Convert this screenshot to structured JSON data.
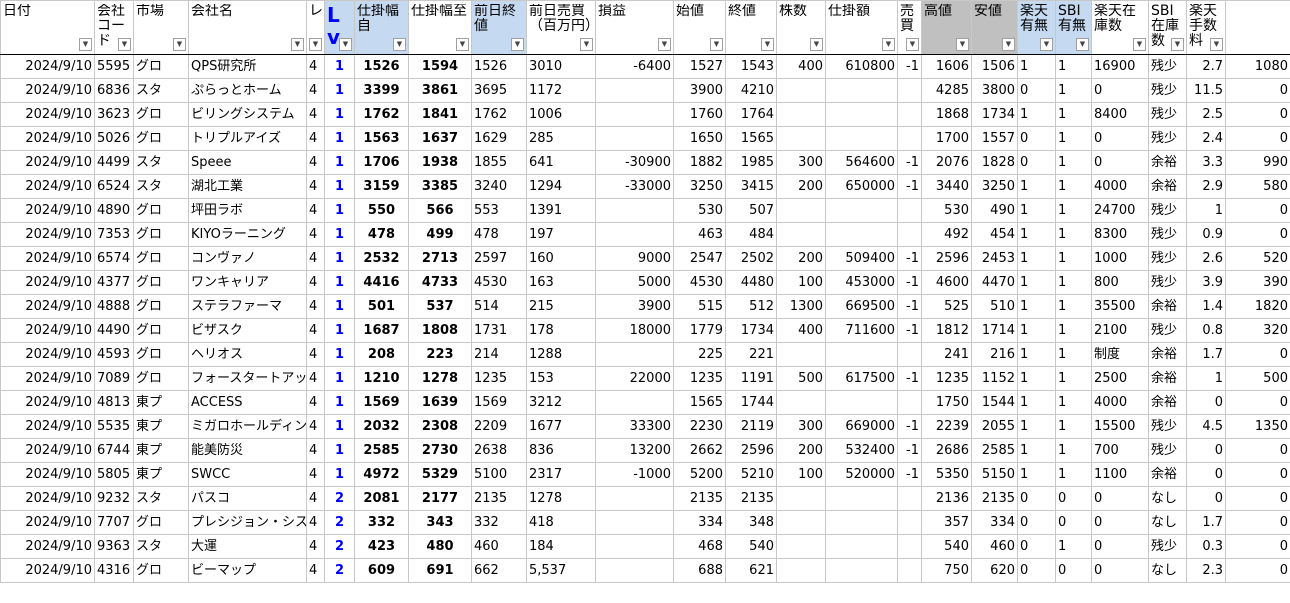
{
  "columns": [
    {
      "key": "date",
      "label": "日付"
    },
    {
      "key": "code",
      "label": "会社コード"
    },
    {
      "key": "market",
      "label": "市場"
    },
    {
      "key": "name",
      "label": "会社名"
    },
    {
      "key": "lev",
      "label": "レ"
    },
    {
      "key": "lv",
      "label": "Lv"
    },
    {
      "key": "from",
      "label": "仕掛幅自"
    },
    {
      "key": "to",
      "label": "仕掛幅至"
    },
    {
      "key": "prev_close",
      "label": "前日終値"
    },
    {
      "key": "prev_volume",
      "label": "前日売買（百万円）"
    },
    {
      "key": "pnl",
      "label": "損益"
    },
    {
      "key": "open",
      "label": "始値"
    },
    {
      "key": "close",
      "label": "終値"
    },
    {
      "key": "shares",
      "label": "株数"
    },
    {
      "key": "amount",
      "label": "仕掛額"
    },
    {
      "key": "side",
      "label": "売買"
    },
    {
      "key": "high",
      "label": "高値"
    },
    {
      "key": "low",
      "label": "安値"
    },
    {
      "key": "rakuten_ok",
      "label": "楽天有無"
    },
    {
      "key": "sbi_ok",
      "label": "SBI有無"
    },
    {
      "key": "rakuten_stock",
      "label": "楽天在庫数"
    },
    {
      "key": "sbi_stock",
      "label": "SBI在庫数"
    },
    {
      "key": "fee_rate",
      "label": "楽天手数料"
    },
    {
      "key": "fee",
      "label": ""
    }
  ],
  "rows": [
    {
      "date": "2024/9/10",
      "code": "5595",
      "market": "グロ",
      "name": "QPS研究所",
      "lev": "4",
      "lv": "1",
      "from": "1526",
      "to": "1594",
      "prev_close": "1526",
      "prev_volume": "3010",
      "pnl": "-6400",
      "open": "1527",
      "close": "1543",
      "shares": "400",
      "amount": "610800",
      "side": "-1",
      "high": "1606",
      "low": "1506",
      "rakuten_ok": "1",
      "sbi_ok": "1",
      "rakuten_stock": "16900",
      "sbi_stock": "残少",
      "fee_rate": "2.7",
      "fee": "1080"
    },
    {
      "date": "2024/9/10",
      "code": "6836",
      "market": "スタ",
      "name": "ぷらっとホーム",
      "lev": "4",
      "lv": "1",
      "from": "3399",
      "to": "3861",
      "prev_close": "3695",
      "prev_volume": "1172",
      "pnl": "",
      "open": "3900",
      "close": "4210",
      "shares": "",
      "amount": "",
      "side": "",
      "high": "4285",
      "low": "3800",
      "rakuten_ok": "0",
      "sbi_ok": "1",
      "rakuten_stock": "0",
      "sbi_stock": "残少",
      "fee_rate": "11.5",
      "fee": "0"
    },
    {
      "date": "2024/9/10",
      "code": "3623",
      "market": "グロ",
      "name": "ビリングシステム",
      "lev": "4",
      "lv": "1",
      "from": "1762",
      "to": "1841",
      "prev_close": "1762",
      "prev_volume": "1006",
      "pnl": "",
      "open": "1760",
      "close": "1764",
      "shares": "",
      "amount": "",
      "side": "",
      "high": "1868",
      "low": "1734",
      "rakuten_ok": "1",
      "sbi_ok": "1",
      "rakuten_stock": "8400",
      "sbi_stock": "残少",
      "fee_rate": "2.5",
      "fee": "0"
    },
    {
      "date": "2024/9/10",
      "code": "5026",
      "market": "グロ",
      "name": "トリプルアイズ",
      "lev": "4",
      "lv": "1",
      "from": "1563",
      "to": "1637",
      "prev_close": "1629",
      "prev_volume": "285",
      "pnl": "",
      "open": "1650",
      "close": "1565",
      "shares": "",
      "amount": "",
      "side": "",
      "high": "1700",
      "low": "1557",
      "rakuten_ok": "0",
      "sbi_ok": "1",
      "rakuten_stock": "0",
      "sbi_stock": "残少",
      "fee_rate": "2.4",
      "fee": "0"
    },
    {
      "date": "2024/9/10",
      "code": "4499",
      "market": "スタ",
      "name": "Speee",
      "lev": "4",
      "lv": "1",
      "from": "1706",
      "to": "1938",
      "prev_close": "1855",
      "prev_volume": "641",
      "pnl": "-30900",
      "open": "1882",
      "close": "1985",
      "shares": "300",
      "amount": "564600",
      "side": "-1",
      "high": "2076",
      "low": "1828",
      "rakuten_ok": "0",
      "sbi_ok": "1",
      "rakuten_stock": "0",
      "sbi_stock": "余裕",
      "fee_rate": "3.3",
      "fee": "990"
    },
    {
      "date": "2024/9/10",
      "code": "6524",
      "market": "スタ",
      "name": "湖北工業",
      "lev": "4",
      "lv": "1",
      "from": "3159",
      "to": "3385",
      "prev_close": "3240",
      "prev_volume": "1294",
      "pnl": "-33000",
      "open": "3250",
      "close": "3415",
      "shares": "200",
      "amount": "650000",
      "side": "-1",
      "high": "3440",
      "low": "3250",
      "rakuten_ok": "1",
      "sbi_ok": "1",
      "rakuten_stock": "4000",
      "sbi_stock": "余裕",
      "fee_rate": "2.9",
      "fee": "580"
    },
    {
      "date": "2024/9/10",
      "code": "4890",
      "market": "グロ",
      "name": "坪田ラボ",
      "lev": "4",
      "lv": "1",
      "from": "550",
      "to": "566",
      "prev_close": "553",
      "prev_volume": "1391",
      "pnl": "",
      "open": "530",
      "close": "507",
      "shares": "",
      "amount": "",
      "side": "",
      "high": "530",
      "low": "490",
      "rakuten_ok": "1",
      "sbi_ok": "1",
      "rakuten_stock": "24700",
      "sbi_stock": "残少",
      "fee_rate": "1",
      "fee": "0"
    },
    {
      "date": "2024/9/10",
      "code": "7353",
      "market": "グロ",
      "name": "KIYOラーニング",
      "lev": "4",
      "lv": "1",
      "from": "478",
      "to": "499",
      "prev_close": "478",
      "prev_volume": "197",
      "pnl": "",
      "open": "463",
      "close": "484",
      "shares": "",
      "amount": "",
      "side": "",
      "high": "492",
      "low": "454",
      "rakuten_ok": "1",
      "sbi_ok": "1",
      "rakuten_stock": "8300",
      "sbi_stock": "残少",
      "fee_rate": "0.9",
      "fee": "0"
    },
    {
      "date": "2024/9/10",
      "code": "6574",
      "market": "グロ",
      "name": "コンヴァノ",
      "lev": "4",
      "lv": "1",
      "from": "2532",
      "to": "2713",
      "prev_close": "2597",
      "prev_volume": "160",
      "pnl": "9000",
      "open": "2547",
      "close": "2502",
      "shares": "200",
      "amount": "509400",
      "side": "-1",
      "high": "2596",
      "low": "2453",
      "rakuten_ok": "1",
      "sbi_ok": "1",
      "rakuten_stock": "1000",
      "sbi_stock": "残少",
      "fee_rate": "2.6",
      "fee": "520"
    },
    {
      "date": "2024/9/10",
      "code": "4377",
      "market": "グロ",
      "name": "ワンキャリア",
      "lev": "4",
      "lv": "1",
      "from": "4416",
      "to": "4733",
      "prev_close": "4530",
      "prev_volume": "163",
      "pnl": "5000",
      "open": "4530",
      "close": "4480",
      "shares": "100",
      "amount": "453000",
      "side": "-1",
      "high": "4600",
      "low": "4470",
      "rakuten_ok": "1",
      "sbi_ok": "1",
      "rakuten_stock": "800",
      "sbi_stock": "残少",
      "fee_rate": "3.9",
      "fee": "390"
    },
    {
      "date": "2024/9/10",
      "code": "4888",
      "market": "グロ",
      "name": "ステラファーマ",
      "lev": "4",
      "lv": "1",
      "from": "501",
      "to": "537",
      "prev_close": "514",
      "prev_volume": "215",
      "pnl": "3900",
      "open": "515",
      "close": "512",
      "shares": "1300",
      "amount": "669500",
      "side": "-1",
      "high": "525",
      "low": "510",
      "rakuten_ok": "1",
      "sbi_ok": "1",
      "rakuten_stock": "35500",
      "sbi_stock": "余裕",
      "fee_rate": "1.4",
      "fee": "1820"
    },
    {
      "date": "2024/9/10",
      "code": "4490",
      "market": "グロ",
      "name": "ビザスク",
      "lev": "4",
      "lv": "1",
      "from": "1687",
      "to": "1808",
      "prev_close": "1731",
      "prev_volume": "178",
      "pnl": "18000",
      "open": "1779",
      "close": "1734",
      "shares": "400",
      "amount": "711600",
      "side": "-1",
      "high": "1812",
      "low": "1714",
      "rakuten_ok": "1",
      "sbi_ok": "1",
      "rakuten_stock": "2100",
      "sbi_stock": "残少",
      "fee_rate": "0.8",
      "fee": "320"
    },
    {
      "date": "2024/9/10",
      "code": "4593",
      "market": "グロ",
      "name": "ヘリオス",
      "lev": "4",
      "lv": "1",
      "from": "208",
      "to": "223",
      "prev_close": "214",
      "prev_volume": "1288",
      "pnl": "",
      "open": "225",
      "close": "221",
      "shares": "",
      "amount": "",
      "side": "",
      "high": "241",
      "low": "216",
      "rakuten_ok": "1",
      "sbi_ok": "1",
      "rakuten_stock": "制度",
      "sbi_stock": "余裕",
      "fee_rate": "1.7",
      "fee": "0"
    },
    {
      "date": "2024/9/10",
      "code": "7089",
      "market": "グロ",
      "name": "フォースタートアップス",
      "lev": "4",
      "lv": "1",
      "from": "1210",
      "to": "1278",
      "prev_close": "1235",
      "prev_volume": "153",
      "pnl": "22000",
      "open": "1235",
      "close": "1191",
      "shares": "500",
      "amount": "617500",
      "side": "-1",
      "high": "1235",
      "low": "1152",
      "rakuten_ok": "1",
      "sbi_ok": "1",
      "rakuten_stock": "2500",
      "sbi_stock": "余裕",
      "fee_rate": "1",
      "fee": "500"
    },
    {
      "date": "2024/9/10",
      "code": "4813",
      "market": "東プ",
      "name": "ACCESS",
      "lev": "4",
      "lv": "1",
      "from": "1569",
      "to": "1639",
      "prev_close": "1569",
      "prev_volume": "3212",
      "pnl": "",
      "open": "1565",
      "close": "1744",
      "shares": "",
      "amount": "",
      "side": "",
      "high": "1750",
      "low": "1544",
      "rakuten_ok": "1",
      "sbi_ok": "1",
      "rakuten_stock": "4000",
      "sbi_stock": "余裕",
      "fee_rate": "0",
      "fee": "0"
    },
    {
      "date": "2024/9/10",
      "code": "5535",
      "market": "東プ",
      "name": "ミガロホールディングス",
      "lev": "4",
      "lv": "1",
      "from": "2032",
      "to": "2308",
      "prev_close": "2209",
      "prev_volume": "1677",
      "pnl": "33300",
      "open": "2230",
      "close": "2119",
      "shares": "300",
      "amount": "669000",
      "side": "-1",
      "high": "2239",
      "low": "2055",
      "rakuten_ok": "1",
      "sbi_ok": "1",
      "rakuten_stock": "15500",
      "sbi_stock": "残少",
      "fee_rate": "4.5",
      "fee": "1350"
    },
    {
      "date": "2024/9/10",
      "code": "6744",
      "market": "東プ",
      "name": "能美防災",
      "lev": "4",
      "lv": "1",
      "from": "2585",
      "to": "2730",
      "prev_close": "2638",
      "prev_volume": "836",
      "pnl": "13200",
      "open": "2662",
      "close": "2596",
      "shares": "200",
      "amount": "532400",
      "side": "-1",
      "high": "2686",
      "low": "2585",
      "rakuten_ok": "1",
      "sbi_ok": "1",
      "rakuten_stock": "700",
      "sbi_stock": "残少",
      "fee_rate": "0",
      "fee": "0"
    },
    {
      "date": "2024/9/10",
      "code": "5805",
      "market": "東プ",
      "name": "SWCC",
      "lev": "4",
      "lv": "1",
      "from": "4972",
      "to": "5329",
      "prev_close": "5100",
      "prev_volume": "2317",
      "pnl": "-1000",
      "open": "5200",
      "close": "5210",
      "shares": "100",
      "amount": "520000",
      "side": "-1",
      "high": "5350",
      "low": "5150",
      "rakuten_ok": "1",
      "sbi_ok": "1",
      "rakuten_stock": "1100",
      "sbi_stock": "余裕",
      "fee_rate": "0",
      "fee": "0"
    },
    {
      "date": "2024/9/10",
      "code": "9232",
      "market": "スタ",
      "name": "パスコ",
      "lev": "4",
      "lv": "2",
      "from": "2081",
      "to": "2177",
      "prev_close": "2135",
      "prev_volume": "1278",
      "pnl": "",
      "open": "2135",
      "close": "2135",
      "shares": "",
      "amount": "",
      "side": "",
      "high": "2136",
      "low": "2135",
      "rakuten_ok": "0",
      "sbi_ok": "0",
      "rakuten_stock": "0",
      "sbi_stock": "なし",
      "fee_rate": "0",
      "fee": "0"
    },
    {
      "date": "2024/9/10",
      "code": "7707",
      "market": "グロ",
      "name": "プレシジョン・システム・サイエンス",
      "lev": "4",
      "lv": "2",
      "from": "332",
      "to": "343",
      "prev_close": "332",
      "prev_volume": "418",
      "pnl": "",
      "open": "334",
      "close": "348",
      "shares": "",
      "amount": "",
      "side": "",
      "high": "357",
      "low": "334",
      "rakuten_ok": "0",
      "sbi_ok": "0",
      "rakuten_stock": "0",
      "sbi_stock": "なし",
      "fee_rate": "1.7",
      "fee": "0"
    },
    {
      "date": "2024/9/10",
      "code": "9363",
      "market": "スタ",
      "name": "大運",
      "lev": "4",
      "lv": "2",
      "from": "423",
      "to": "480",
      "prev_close": "460",
      "prev_volume": "184",
      "pnl": "",
      "open": "468",
      "close": "540",
      "shares": "",
      "amount": "",
      "side": "",
      "high": "540",
      "low": "460",
      "rakuten_ok": "0",
      "sbi_ok": "1",
      "rakuten_stock": "0",
      "sbi_stock": "残少",
      "fee_rate": "0.3",
      "fee": "0"
    },
    {
      "date": "2024/9/10",
      "code": "4316",
      "market": "グロ",
      "name": "ビーマップ",
      "lev": "4",
      "lv": "2",
      "from": "609",
      "to": "691",
      "prev_close": "662",
      "prev_volume": "5,537",
      "pnl": "",
      "open": "688",
      "close": "621",
      "shares": "",
      "amount": "",
      "side": "",
      "high": "750",
      "low": "620",
      "rakuten_ok": "0",
      "sbi_ok": "0",
      "rakuten_stock": "0",
      "sbi_stock": "なし",
      "fee_rate": "2.3",
      "fee": "0"
    }
  ],
  "icons": {
    "filter": "filter-dropdown-icon"
  },
  "colors": {
    "lv": "#0000ff",
    "header_gray": "#c0c0c0",
    "header_blue": "#c5d9f1"
  }
}
